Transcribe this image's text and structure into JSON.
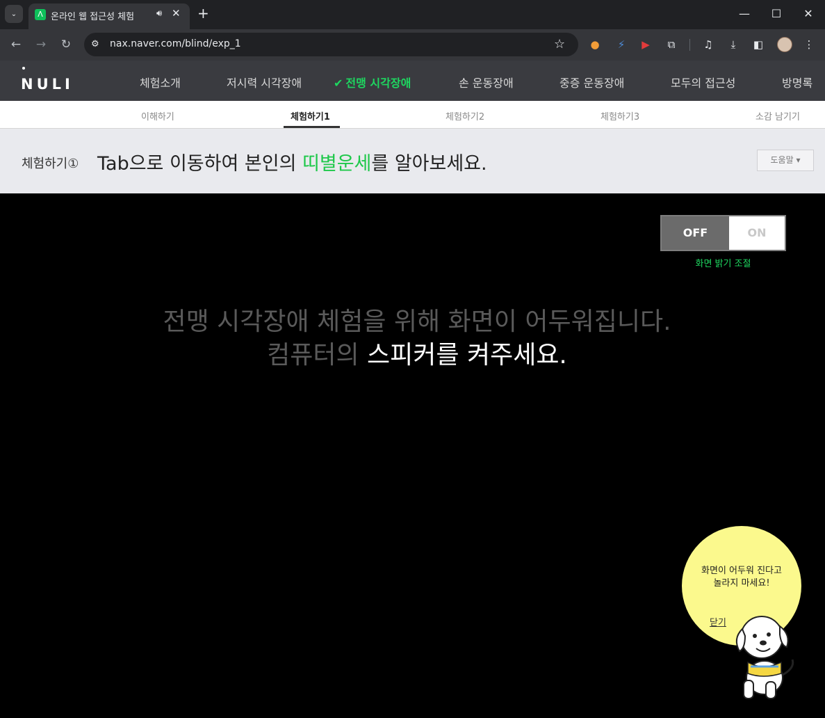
{
  "browser": {
    "tab_title": "온라인 웹 접근성 체험",
    "url": "nax.naver.com/blind/exp_1"
  },
  "site": {
    "logo": "NULI",
    "menu": [
      {
        "label": "체험소개"
      },
      {
        "label": "저시력 시각장애"
      },
      {
        "label": "전맹 시각장애",
        "active": true
      },
      {
        "label": "손 운동장애"
      },
      {
        "label": "중증 운동장애"
      },
      {
        "label": "모두의 접근성"
      },
      {
        "label": "방명록"
      }
    ],
    "submenu": [
      {
        "label": "이해하기"
      },
      {
        "label": "체험하기1",
        "active": true
      },
      {
        "label": "체험하기2"
      },
      {
        "label": "체험하기3"
      },
      {
        "label": "소감 남기기"
      }
    ]
  },
  "heading": {
    "step": "체험하기①",
    "text_before": "Tab으로 이동하여 본인의 ",
    "text_highlight": "띠별운세",
    "text_after": "를 알아보세요.",
    "help_button": "도움말 ▾"
  },
  "toggle": {
    "off_label": "OFF",
    "on_label": "ON",
    "caption": "화면 밝기 조절",
    "state": "OFF"
  },
  "message": {
    "line1": "전맹 시각장애 체험을 위해 화면이 어두워집니다.",
    "line2_dim": "컴퓨터의 ",
    "line2_bright": "스피커를 켜주세요."
  },
  "bubble": {
    "line1": "화면이 어두워 진다고",
    "line2": "놀라지 마세요!",
    "close_label": "닫기"
  },
  "colors": {
    "accent_green": "#1ed760",
    "bubble_yellow": "#fbf98d"
  }
}
